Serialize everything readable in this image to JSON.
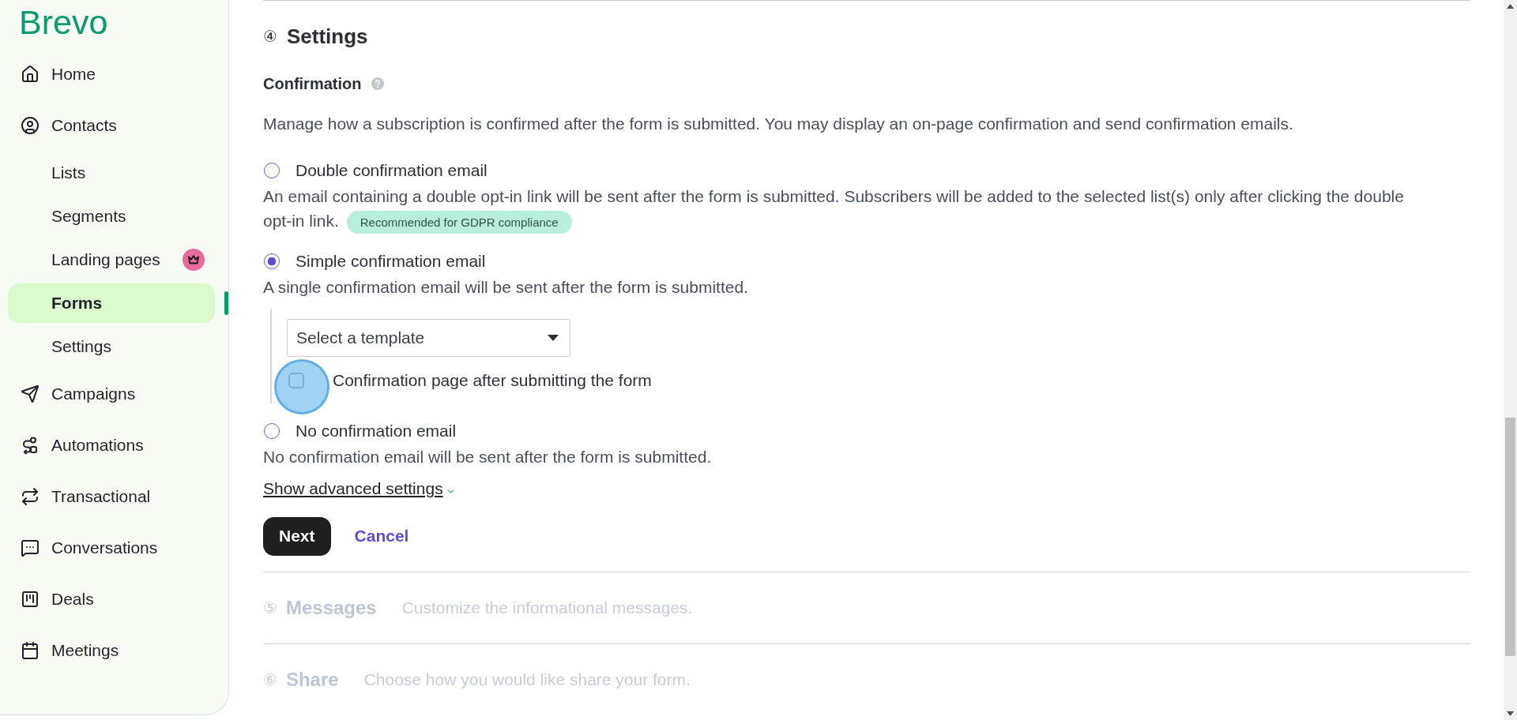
{
  "sidebar": {
    "logo": "Brevo",
    "items": [
      {
        "label": "Home",
        "selected": false
      },
      {
        "label": "Contacts",
        "selected": false,
        "children": [
          {
            "label": "Lists",
            "selected": false,
            "premium": false
          },
          {
            "label": "Segments",
            "selected": false,
            "premium": false
          },
          {
            "label": "Landing pages",
            "selected": false,
            "premium": true
          },
          {
            "label": "Forms",
            "selected": true,
            "premium": false
          },
          {
            "label": "Settings",
            "selected": false,
            "premium": false
          }
        ]
      },
      {
        "label": "Campaigns",
        "selected": false
      },
      {
        "label": "Automations",
        "selected": false
      },
      {
        "label": "Transactional",
        "selected": false
      },
      {
        "label": "Conversations",
        "selected": false
      },
      {
        "label": "Deals",
        "selected": false
      },
      {
        "label": "Meetings",
        "selected": false
      }
    ]
  },
  "settings_step": {
    "number": "④",
    "title": "Settings",
    "confirmation": {
      "title": "Confirmation",
      "description": "Manage how a subscription is confirmed after the form is submitted. You may display an on-page confirmation and send confirmation emails.",
      "options": [
        {
          "label": "Double confirmation email",
          "selected": false,
          "description": "An email containing a double opt-in link will be sent after the form is submitted. Subscribers will be added to the selected list(s) only after clicking the double opt-in link.",
          "badge": "Recommended for GDPR compliance"
        },
        {
          "label": "Simple confirmation email",
          "selected": true,
          "description": "A single confirmation email will be sent after the form is submitted.",
          "template_select": {
            "placeholder": "Select a template"
          },
          "confirmation_page": {
            "label": "Confirmation page after submitting the form",
            "checked": false
          }
        },
        {
          "label": "No confirmation email",
          "selected": false,
          "description": "No confirmation email will be sent after the form is submitted."
        }
      ]
    },
    "advanced_link": "Show advanced settings",
    "buttons": {
      "next": "Next",
      "cancel": "Cancel"
    }
  },
  "next_steps": [
    {
      "number": "⑤",
      "title": "Messages",
      "description": "Customize the informational messages.",
      "disabled": true
    },
    {
      "number": "⑥",
      "title": "Share",
      "description": "Choose how you would like share your form.",
      "disabled": true
    }
  ]
}
